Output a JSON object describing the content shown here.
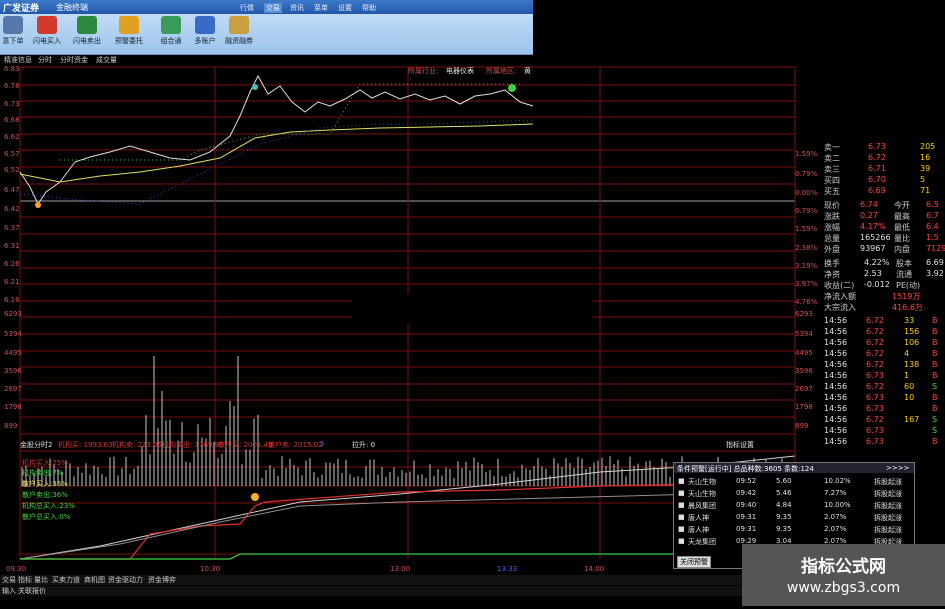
{
  "app": {
    "brand": "广发证券",
    "subtitle": "金融终端",
    "menus": [
      "行情",
      "交易",
      "资讯",
      "菜单",
      "设置",
      "帮助"
    ],
    "toolbar": [
      "意下单",
      "闪电买入",
      "闪电卖出",
      "预警委托",
      "组合通",
      "多账户",
      "融资融券"
    ]
  },
  "chart_tabs": [
    "精准信息",
    "分时",
    "分时资金",
    "成交量"
  ],
  "sector": {
    "label": "所属行业:",
    "value": "电器仪表",
    "label2": "所属地区:",
    "value2": "黄"
  },
  "price_axis": [
    "6.83",
    "6.78",
    "6.73",
    "6.68",
    "6.62",
    "6.57",
    "6.52",
    "6.47",
    "6.42",
    "6.37",
    "6.31",
    "6.26",
    "6.21",
    "6.16"
  ],
  "pct_axis": [
    "1.59%",
    "0.79%",
    "0.00%",
    "0.79%",
    "1.59%",
    "2.38%",
    "3.19%",
    "3.97%",
    "4.76%"
  ],
  "vol_axis": [
    "6293",
    "5394",
    "4495",
    "3596",
    "2697",
    "1798",
    "899"
  ],
  "indicator_bar": {
    "name": "金股分时2",
    "items": [
      "机构买: 1993.63",
      "机构卖: 223.05",
      "机构卖出: 1769.97",
      "散户买: 2001.43",
      "散户卖: 2015.02"
    ],
    "extra1": "5",
    "extra2": "拉升: 0",
    "settings": "指标设置"
  },
  "legend": [
    "机构买入:25%",
    "机构卖出:7%",
    "散户买入:36%",
    "散户卖出:36%",
    "机构总买入:23%",
    "散户总买入:0%"
  ],
  "time_axis": [
    "09:30",
    "10:30",
    "13:00",
    "13:33",
    "14:00"
  ],
  "order_book": [
    {
      "label": "卖一",
      "price": "6.73",
      "vol": "205"
    },
    {
      "label": "卖二",
      "price": "6.72",
      "vol": "16"
    },
    {
      "label": "卖三",
      "price": "6.71",
      "vol": "39"
    },
    {
      "label": "买四",
      "price": "6.70",
      "vol": "5"
    },
    {
      "label": "买五",
      "price": "6.69",
      "vol": "71"
    }
  ],
  "quote_stats": [
    {
      "l1": "现价",
      "v1": "6.74",
      "l2": "今开",
      "v2": "6.5"
    },
    {
      "l1": "涨跌",
      "v1": "0.27",
      "l2": "最高",
      "v2": "6.7"
    },
    {
      "l1": "涨幅",
      "v1": "4.17%",
      "l2": "最低",
      "v2": "6.4"
    },
    {
      "l1": "总量",
      "v1": "165266",
      "l2": "量比",
      "v2": "1.5"
    },
    {
      "l1": "外盘",
      "v1": "93967",
      "l2": "内盘",
      "v2": "7129"
    }
  ],
  "quote_stats2": [
    {
      "l1": "换手",
      "v1": "4.22%",
      "l2": "股本",
      "v2": "6.69"
    },
    {
      "l1": "净资",
      "v1": "2.53",
      "l2": "流通",
      "v2": "3.92"
    },
    {
      "l1": "收益(二)",
      "v1": "-0.012",
      "l2": "PE(动)",
      "v2": ""
    }
  ],
  "flow": [
    {
      "label": "净流入额",
      "value": "1519万"
    },
    {
      "label": "大宗流入",
      "value": "416.6万"
    }
  ],
  "ticks": [
    {
      "t": "14:56",
      "p": "6.72",
      "v": "33",
      "s": "B"
    },
    {
      "t": "14:56",
      "p": "6.72",
      "v": "156",
      "s": "B"
    },
    {
      "t": "14:56",
      "p": "6.72",
      "v": "106",
      "s": "B"
    },
    {
      "t": "14:56",
      "p": "6.72",
      "v": "4",
      "s": "B"
    },
    {
      "t": "14:56",
      "p": "6.72",
      "v": "138",
      "s": "B"
    },
    {
      "t": "14:56",
      "p": "6.73",
      "v": "1",
      "s": "B"
    },
    {
      "t": "14:56",
      "p": "6.72",
      "v": "60",
      "s": "S"
    },
    {
      "t": "14:56",
      "p": "6.73",
      "v": "10",
      "s": "B"
    },
    {
      "t": "14:56",
      "p": "6.73",
      "v": "",
      "s": "B"
    },
    {
      "t": "14:56",
      "p": "6.72",
      "v": "167",
      "s": "S"
    },
    {
      "t": "14:56",
      "p": "6.73",
      "v": "",
      "s": "S"
    },
    {
      "t": "14:56",
      "p": "6.73",
      "v": "",
      "s": "B"
    }
  ],
  "popup": {
    "title": "条件预警[运行中] 总品种数:3605 条数:124",
    "arrows": ">>>>",
    "rows": [
      {
        "name": "天山生物",
        "time": "09:52",
        "price": "5.60",
        "pct": "10.02%",
        "tag": "拆股起涨"
      },
      {
        "name": "天山生物",
        "time": "09:42",
        "price": "5.46",
        "pct": "7.27%",
        "tag": "拆股起涨"
      },
      {
        "name": "晨风集团",
        "time": "09:40",
        "price": "4.84",
        "pct": "10.00%",
        "tag": "拆股起涨"
      },
      {
        "name": "唐人神",
        "time": "09:31",
        "price": "9.35",
        "pct": "2.07%",
        "tag": "拆股起涨"
      },
      {
        "name": "唐人神",
        "time": "09:31",
        "price": "9.35",
        "pct": "2.07%",
        "tag": "拆股起涨"
      },
      {
        "name": "天龙集团",
        "time": "09:29",
        "price": "3.04",
        "pct": "2.07%",
        "tag": "拆股起涨"
      }
    ],
    "close": "关闭预警"
  },
  "bottom_tabs": [
    "交易",
    "指标",
    "量比",
    "买卖力道",
    "商机图",
    "资金驱动力",
    "资金博弈"
  ],
  "bottom_tabs2": [
    "输入",
    "关联报价"
  ],
  "watermark": {
    "line1": "指标公式网",
    "line2": "www.zbgs3.com"
  },
  "colors": {
    "grid": "#7a1010",
    "price_line": "#e0e0e0",
    "avg_line": "#e0e060",
    "up": "#ff4040",
    "down": "#40e040"
  }
}
